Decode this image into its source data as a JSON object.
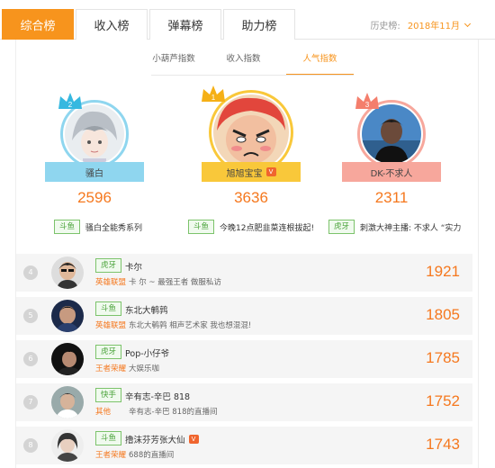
{
  "tabs": [
    {
      "label": "综合榜",
      "active": true
    },
    {
      "label": "收入榜"
    },
    {
      "label": "弹幕榜"
    },
    {
      "label": "助力榜"
    }
  ],
  "history": {
    "label": "历史榜:",
    "value": "2018年11月"
  },
  "subtabs": [
    {
      "label": "小葫芦指数"
    },
    {
      "label": "收入指数"
    },
    {
      "label": "人气指数",
      "active": true
    }
  ],
  "top3": [
    {
      "rank": "2",
      "name": "骚白",
      "score": "2596",
      "platform": "斗鱼",
      "desc": "骚白全能秀系列",
      "theme": "#8fd6ef"
    },
    {
      "rank": "1",
      "name": "旭旭宝宝",
      "score": "3636",
      "platform": "斗鱼",
      "desc": "今晚12点肥韭菜连根拔起!",
      "theme": "#f9c83a",
      "verified": "V"
    },
    {
      "rank": "3",
      "name": "DK-不求人",
      "score": "2311",
      "platform": "虎牙",
      "desc": "刺激大神主播: 不求人 “实力",
      "theme": "#f7a79c"
    }
  ],
  "rows": [
    {
      "rank": "4",
      "platform": "虎牙",
      "name": "卡尔",
      "category": "英雄联盟",
      "desc": "卡 尔 ~ 最强王者 做服私访",
      "score": "1921"
    },
    {
      "rank": "5",
      "platform": "斗鱼",
      "name": "东北大鹌鹑",
      "category": "英雄联盟",
      "desc": "东北大鹌鹑 相声艺术家 我也想混混!",
      "score": "1805"
    },
    {
      "rank": "6",
      "platform": "虎牙",
      "name": "Pop-小仔爷",
      "category": "王者荣耀",
      "desc": "大娱乐咖",
      "score": "1785"
    },
    {
      "rank": "7",
      "platform": "快手",
      "name": "辛有志-辛巴 818",
      "category": "其他",
      "desc": "辛有志-辛巴 818的直播间",
      "score": "1752"
    },
    {
      "rank": "8",
      "platform": "斗鱼",
      "name": "撸沫芬芳张大仙",
      "category": "王者荣耀",
      "desc": "688的直播间",
      "score": "1743",
      "verified": "V"
    }
  ],
  "colors": {
    "accent": "#f7941d",
    "score": "#f5781e",
    "platform_green": "#4aa33a"
  }
}
